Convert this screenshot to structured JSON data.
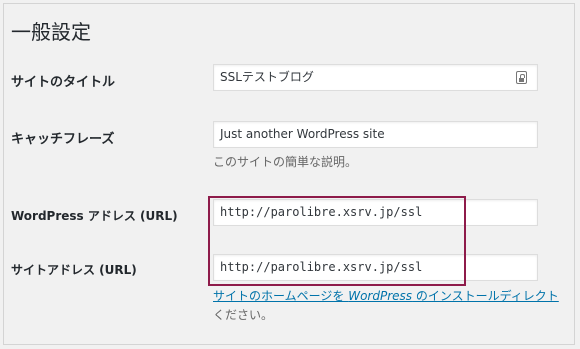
{
  "page": {
    "title": "一般設定"
  },
  "fields": {
    "site_title": {
      "label": "サイトのタイトル",
      "value": "SSLテストブログ"
    },
    "tagline": {
      "label": "キャッチフレーズ",
      "value": "Just another WordPress site",
      "description": "このサイトの簡単な説明。"
    },
    "wp_address": {
      "label": "WordPress アドレス (URL)",
      "value": "http://parolibre.xsrv.jp/ssl"
    },
    "site_address": {
      "label": "サイトアドレス (URL)",
      "value": "http://parolibre.xsrv.jp/ssl",
      "help_link_prefix": "サイトのホームページを ",
      "help_link_wp": "WordPress",
      "help_link_suffix": " のインストールディレクト",
      "help_line2": "ください。"
    }
  },
  "colors": {
    "highlight": "#8e1b4a",
    "link": "#0073aa"
  },
  "icons": {
    "site_title_field": "password-manager-icon"
  }
}
